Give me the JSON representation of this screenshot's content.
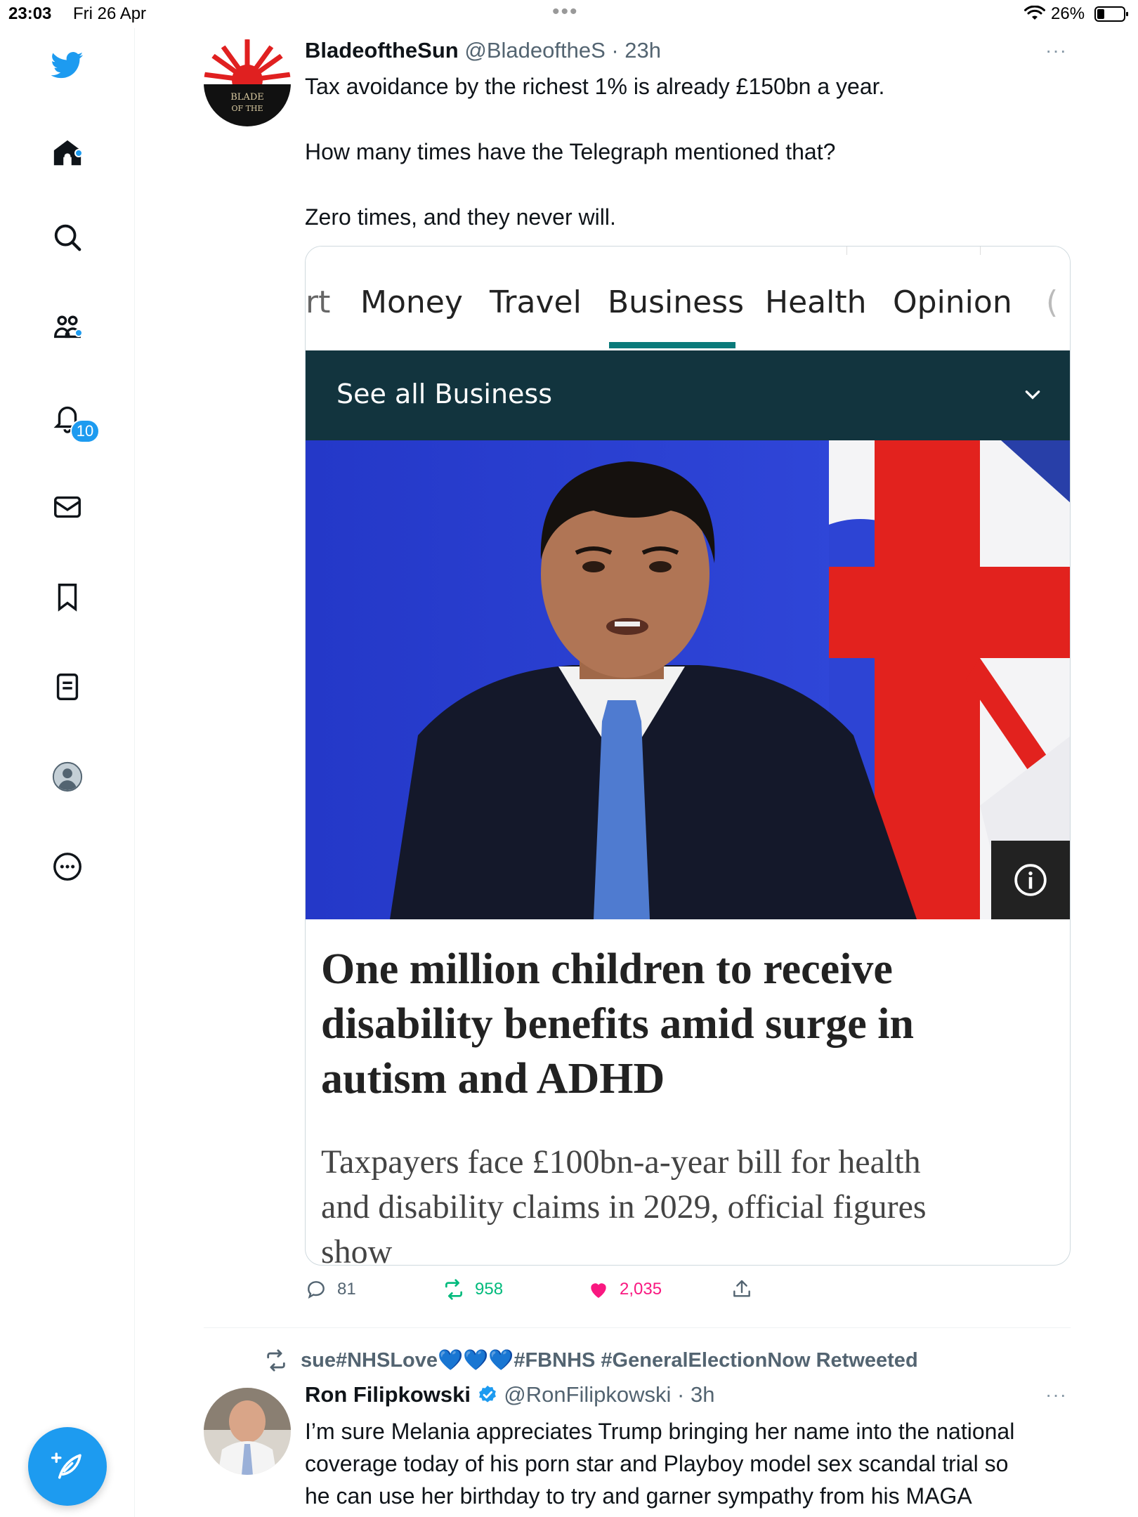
{
  "status_bar": {
    "time": "23:03",
    "date": "Fri 26 Apr",
    "battery_pct": "26%",
    "multitask_dots": "•••"
  },
  "sidebar": {
    "icons": [
      "twitter-logo",
      "home-icon",
      "search-icon",
      "communities-icon",
      "notifications-icon",
      "messages-icon",
      "bookmarks-icon",
      "lists-icon",
      "profile-icon",
      "more-icon"
    ],
    "notifications_count": "10",
    "accent_color": "#1d9bf0"
  },
  "tweet1": {
    "name": "BladeoftheSun",
    "handle": "@BladeoftheS",
    "time": "· 23h",
    "more": "···",
    "avatar_text_line1": "BLADE",
    "avatar_text_line2": "OF THE",
    "lines": [
      "Tax avoidance by the richest 1% is already £150bn a year.",
      "How many times have the Telegraph mentioned that?",
      "Zero times, and they never will."
    ],
    "card": {
      "tabs": [
        "rt",
        "Money",
        "Travel",
        "Business",
        "Health",
        "Opinion",
        "("
      ],
      "active_tab": "Business",
      "band_label": "See all Business",
      "headline_lines": [
        "One million children to receive",
        "disability benefits amid surge in",
        "autism and ADHD"
      ],
      "sub_lines": [
        "Taxpayers face £100bn-a-year bill for health",
        "and disability claims in 2029, official figures",
        "show"
      ]
    },
    "actions": {
      "replies": "81",
      "retweets": "958",
      "likes": "2,035"
    }
  },
  "tweet2": {
    "retweeted_by": "sue#NHSLove💙💙💙#FBNHS #GeneralElectionNow Retweeted",
    "name": "Ron Filipkowski",
    "handle": "@RonFilipkowski",
    "time": "· 3h",
    "more": "···",
    "lines": [
      "I’m sure Melania appreciates Trump bringing her name into the national",
      "coverage today of his porn star and Playboy model sex scandal trial so",
      "he can use her birthday to try and garner sympathy from his MAGA"
    ]
  }
}
